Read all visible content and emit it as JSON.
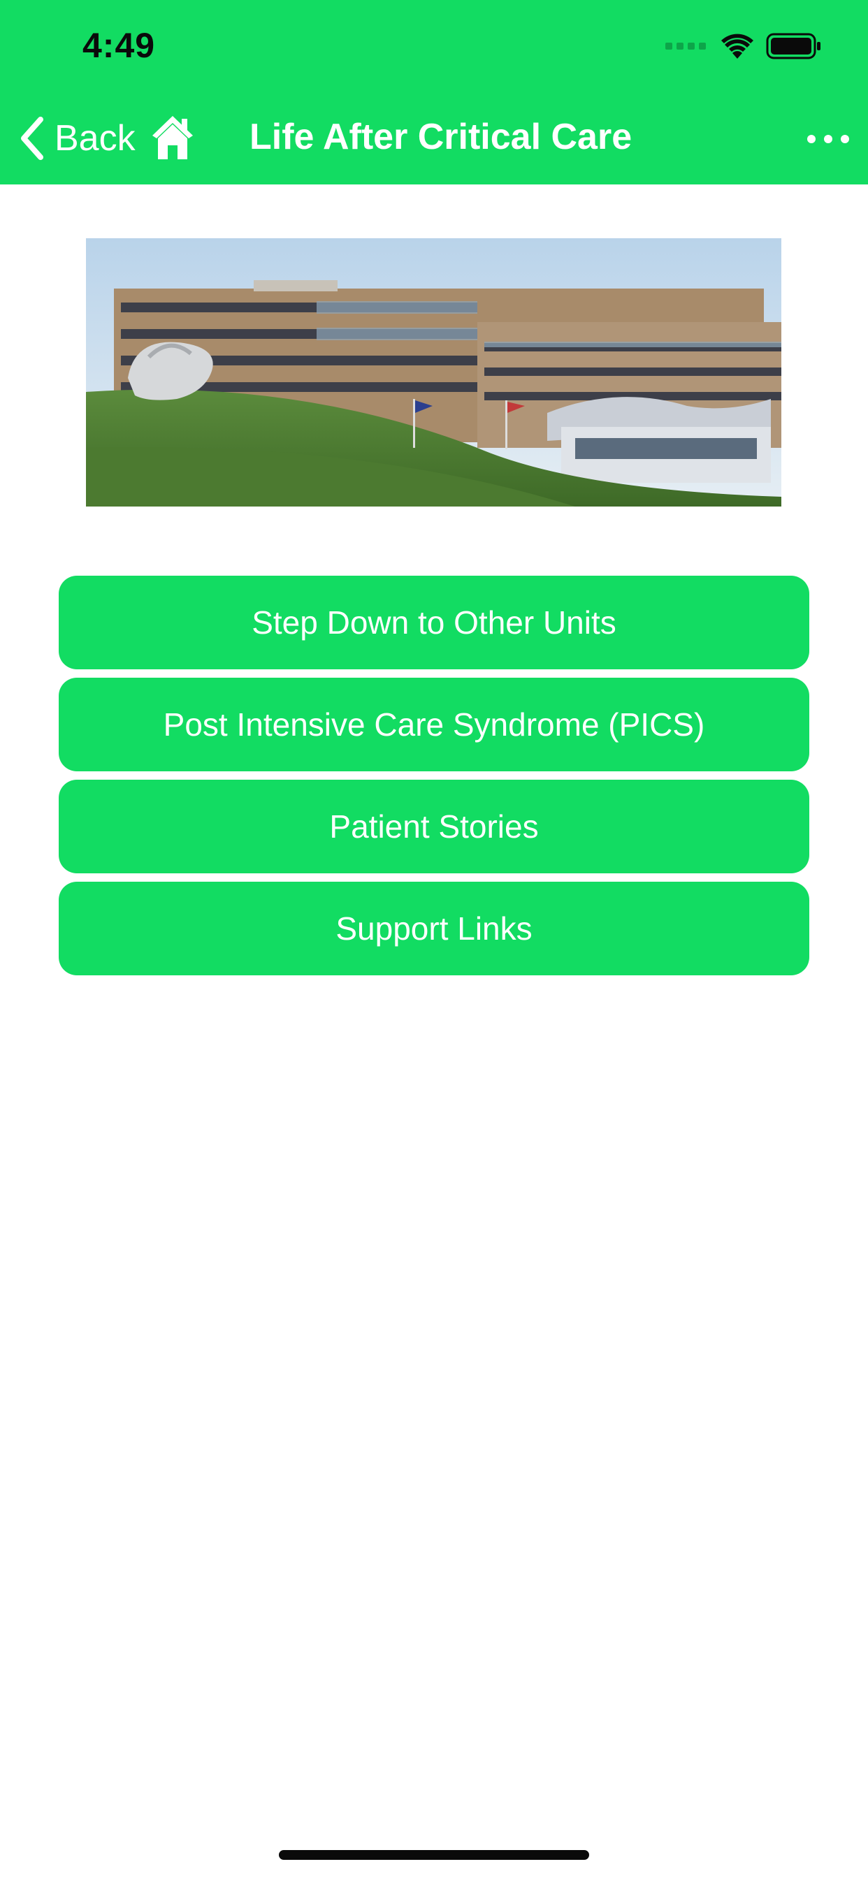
{
  "status_bar": {
    "time": "4:49",
    "icons": [
      "signal-icon",
      "wifi-icon",
      "battery-icon"
    ]
  },
  "nav": {
    "back_label": "Back",
    "title": "Life After Critical Care",
    "icons": [
      "chevron-left-icon",
      "home-icon",
      "more-icon"
    ]
  },
  "hero_image": {
    "description_icon": "hospital-building-photo"
  },
  "menu": {
    "items": [
      {
        "label": "Step Down to Other Units"
      },
      {
        "label": "Post Intensive Care Syndrome (PICS)"
      },
      {
        "label": "Patient Stories"
      },
      {
        "label": "Support Links"
      }
    ]
  },
  "colors": {
    "accent": "#12dc62",
    "text_on_accent": "#ffffff",
    "background": "#ffffff"
  }
}
